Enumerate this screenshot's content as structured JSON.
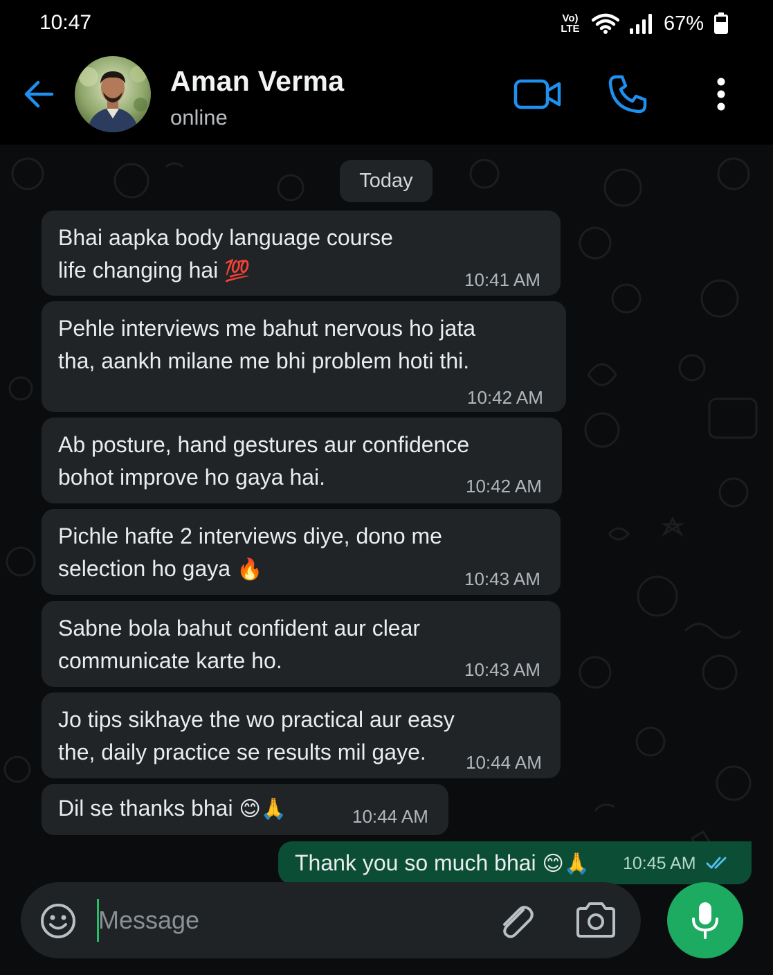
{
  "status_bar": {
    "time": "10:47",
    "network_top": "Vo)",
    "network_bottom": "LTE",
    "battery": "67%"
  },
  "header": {
    "contact_name": "Aman Verma",
    "contact_status": "online",
    "icons": [
      "back-arrow-icon",
      "video-call-icon",
      "phone-call-icon",
      "more-options-icon"
    ]
  },
  "chat": {
    "date_label": "Today",
    "incoming": [
      {
        "text": "Bhai aapka body language course\nlife changing hai ",
        "emoji": "💯",
        "time": "10:41 AM"
      },
      {
        "text": "Pehle interviews me bahut nervous ho jata\ntha, aankh milane me bhi problem hoti thi.",
        "emoji": "",
        "time": "10:42 AM"
      },
      {
        "text": "Ab posture, hand gestures aur confidence\nbohot improve ho gaya hai.",
        "emoji": "",
        "time": "10:42 AM"
      },
      {
        "text": "Pichle hafte 2 interviews diye, dono me\nselection ho gaya ",
        "emoji": "🔥",
        "time": "10:43 AM"
      },
      {
        "text": "Sabne bola bahut confident aur clear\ncommunicate karte ho.",
        "emoji": "",
        "time": "10:43 AM"
      },
      {
        "text": "Jo tips sikhaye the wo practical aur easy\nthe, daily practice se results mil gaye.",
        "emoji": "",
        "time": "10:44 AM"
      },
      {
        "text": "Dil se thanks bhai ",
        "emoji": "😊🙏",
        "time": "10:44 AM"
      }
    ],
    "outgoing": {
      "text": "Thank you so much bhai ",
      "emoji": "😊🙏",
      "time": "10:45 AM",
      "read_status": "double-tick-read"
    }
  },
  "input_bar": {
    "placeholder": "Message",
    "value": ""
  },
  "colors": {
    "background": "#000000",
    "incoming_bubble": "#202427",
    "outgoing_bubble": "#0b4d35",
    "accent_blue": "#1f8ff0",
    "mic_green": "#1daa61",
    "read_tick": "#53bdeb"
  }
}
